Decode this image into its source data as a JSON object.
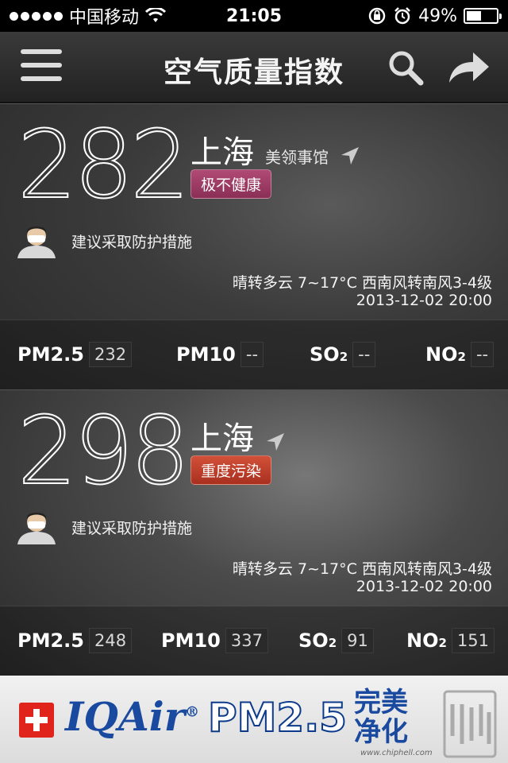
{
  "status_bar": {
    "carrier": "中国移动",
    "time": "21:05",
    "battery": "49%",
    "battery_level": 0.49
  },
  "nav": {
    "title": "空气质量指数"
  },
  "cards": [
    {
      "aqi": "282",
      "city": "上海",
      "station": "美领事馆",
      "level": "极不健康",
      "advice": "建议采取防护措施",
      "weather": "晴转多云 7~17°C 西南风转南风3-4级",
      "timestamp": "2013-12-02 20:00",
      "pollutants": {
        "pm25_label": "PM2.5",
        "pm25": "232",
        "pm10_label": "PM10",
        "pm10": "--",
        "so2_label": "SO",
        "so2_sub": "2",
        "so2": "--",
        "no2_label": "NO",
        "no2_sub": "2",
        "no2": "--"
      }
    },
    {
      "aqi": "298",
      "city": "上海",
      "level": "重度污染",
      "advice": "建议采取防护措施",
      "weather": "晴转多云 7~17°C 西南风转南风3-4级",
      "timestamp": "2013-12-02 20:00",
      "pollutants": {
        "pm25_label": "PM2.5",
        "pm25": "248",
        "pm10_label": "PM10",
        "pm10": "337",
        "so2_label": "SO",
        "so2_sub": "2",
        "so2": "91",
        "no2_label": "NO",
        "no2_sub": "2",
        "no2": "151"
      }
    }
  ],
  "ad": {
    "brand": "IQAir",
    "reg": "®",
    "product": "PM2.5",
    "slogan_line1": "完美",
    "slogan_line2": "净化",
    "url": "www.chiphell.com"
  },
  "colors": {
    "badge_very_unhealthy": "#9c3a63",
    "badge_heavy": "#c0412a",
    "brand_blue": "#1a4aa0"
  }
}
